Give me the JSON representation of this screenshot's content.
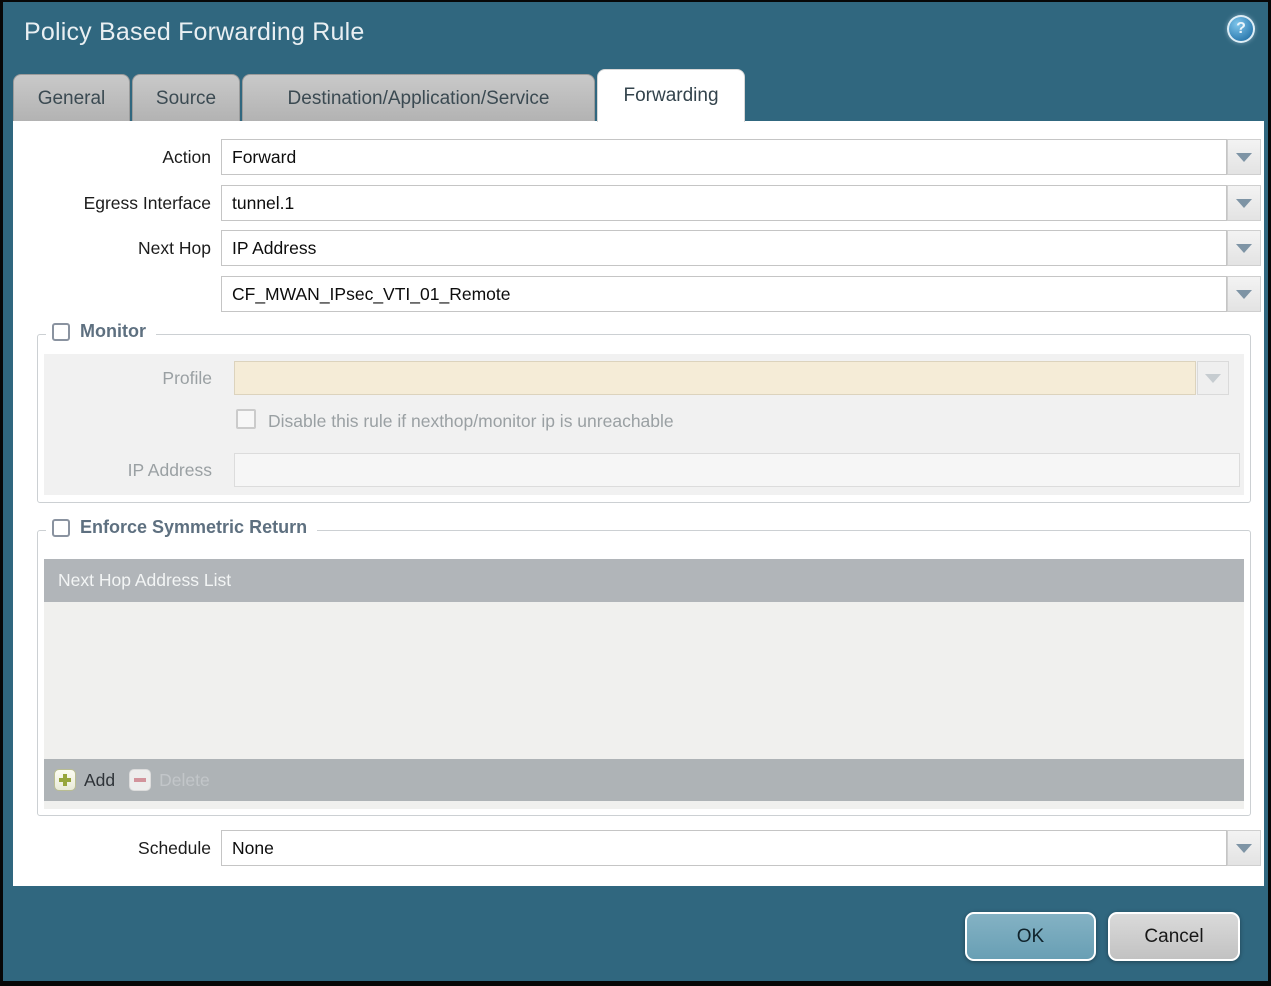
{
  "dialog": {
    "title": "Policy Based Forwarding Rule",
    "help_glyph": "?"
  },
  "tabs": [
    {
      "label": "General",
      "active": false
    },
    {
      "label": "Source",
      "active": false
    },
    {
      "label": "Destination/Application/Service",
      "active": false
    },
    {
      "label": "Forwarding",
      "active": true
    }
  ],
  "form": {
    "action": {
      "label": "Action",
      "value": "Forward"
    },
    "egress_interface": {
      "label": "Egress Interface",
      "value": "tunnel.1"
    },
    "next_hop": {
      "label": "Next Hop",
      "value": "IP Address"
    },
    "next_hop_address": {
      "value": "CF_MWAN_IPsec_VTI_01_Remote"
    },
    "schedule": {
      "label": "Schedule",
      "value": "None"
    }
  },
  "monitor": {
    "legend": "Monitor",
    "checked": false,
    "profile": {
      "label": "Profile",
      "value": ""
    },
    "disable_rule_label": "Disable this rule if nexthop/monitor ip is unreachable",
    "disable_rule_checked": false,
    "ip_address": {
      "label": "IP Address",
      "value": ""
    }
  },
  "enforce_symmetric_return": {
    "legend": "Enforce Symmetric Return",
    "checked": false,
    "table_header": "Next Hop Address List",
    "rows": [],
    "add_label": "Add",
    "delete_label": "Delete",
    "delete_enabled": false
  },
  "footer": {
    "ok_label": "OK",
    "cancel_label": "Cancel"
  },
  "icons": {
    "help": "question-mark-circle",
    "dropdown": "chevron-down-triangle",
    "add": "plus",
    "delete": "minus"
  },
  "colors": {
    "titlebar_background": "#30677f",
    "active_tab_background": "#ffffff",
    "inactive_tab_background": "#bdbdbd",
    "disabled_profile_field": "#f5ecd7",
    "group_legend_text": "#5e7080",
    "table_header_background": "#b1b5b9",
    "ok_button_background": "#6fa5b9",
    "cancel_button_background": "#cccccc"
  }
}
